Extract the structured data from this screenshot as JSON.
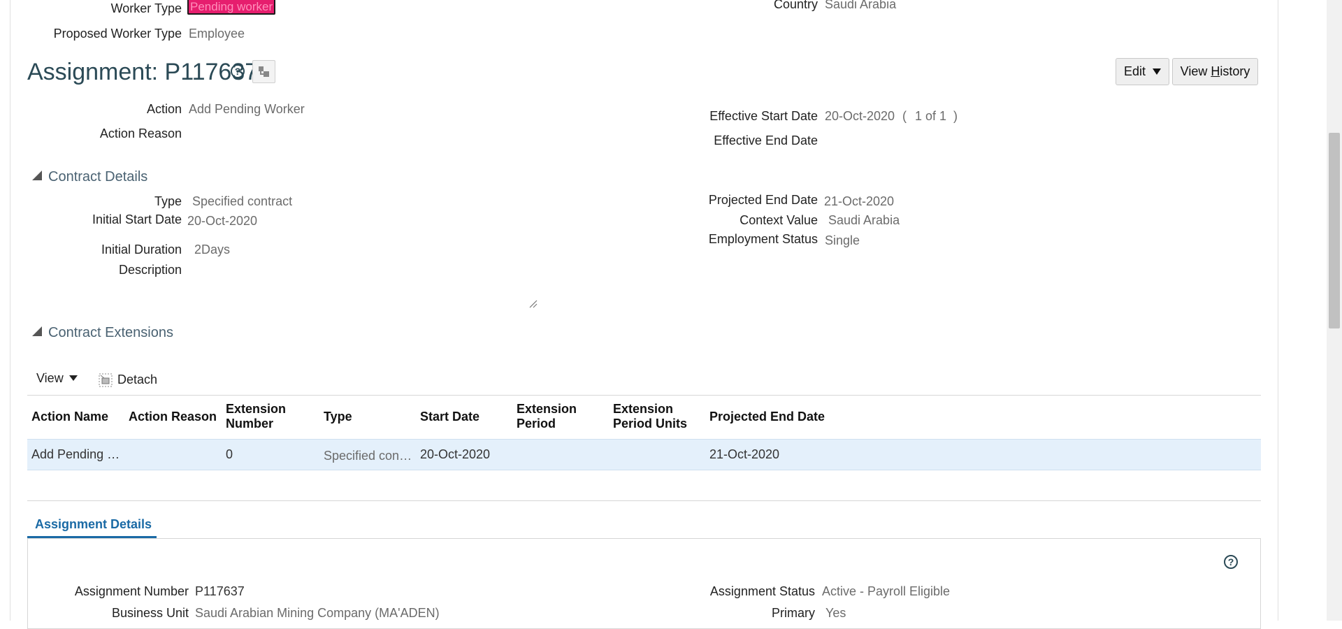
{
  "top": {
    "worker_type_label": "Worker Type",
    "worker_type_value": "Pending worker",
    "proposed_worker_type_label": "Proposed Worker Type",
    "proposed_worker_type_value": "Employee",
    "country_label": "Country",
    "country_value": "Saudi Arabia"
  },
  "assignment": {
    "title": "Assignment: P117637",
    "edit_label": "Edit",
    "view_history_pre": "View ",
    "view_history_ul": "H",
    "view_history_post": "istory",
    "action_label": "Action",
    "action_value": "Add Pending Worker",
    "action_reason_label": "Action Reason",
    "action_reason_value": "",
    "effective_start_label": "Effective Start Date",
    "effective_start_value": "20-Oct-2020",
    "effective_paren_open": "(",
    "effective_count": "1 of 1",
    "effective_paren_close": ")",
    "effective_end_label": "Effective End Date",
    "effective_end_value": ""
  },
  "contract_details": {
    "title": "Contract Details",
    "type_label": "Type",
    "type_value": "Specified contract",
    "initial_start_label": "Initial Start Date",
    "initial_start_value": "20-Oct-2020",
    "initial_duration_label": "Initial Duration",
    "initial_duration_value": "2Days",
    "description_label": "Description",
    "description_value": "",
    "projected_end_label": "Projected End Date",
    "projected_end_value": "21-Oct-2020",
    "context_value_label": "Context Value",
    "context_value_value": "Saudi Arabia",
    "employment_status_label": "Employment Status",
    "employment_status_value": "Single"
  },
  "contract_extensions": {
    "title": "Contract Extensions",
    "view_label": "View",
    "detach_label": "Detach",
    "columns": [
      {
        "line1": "Action Name",
        "line2": ""
      },
      {
        "line1": "Action Reason",
        "line2": ""
      },
      {
        "line1": "Extension",
        "line2": "Number"
      },
      {
        "line1": "Type",
        "line2": ""
      },
      {
        "line1": "Start Date",
        "line2": ""
      },
      {
        "line1": "Extension",
        "line2": "Period"
      },
      {
        "line1": "Extension",
        "line2": "Period Units"
      },
      {
        "line1": "Projected End Date",
        "line2": ""
      }
    ],
    "rows": [
      {
        "action_name": "Add Pending …",
        "action_reason": "",
        "extension_number": "0",
        "type": "Specified con…",
        "start_date": "20-Oct-2020",
        "extension_period": "",
        "extension_period_units": "",
        "projected_end_date": "21-Oct-2020"
      }
    ]
  },
  "assignment_details": {
    "tab_label": "Assignment Details",
    "assignment_number_label": "Assignment Number",
    "assignment_number_value": "P117637",
    "business_unit_label": "Business Unit",
    "business_unit_value": "Saudi Arabian Mining Company (MA'ADEN)",
    "assignment_status_label": "Assignment Status",
    "assignment_status_value": "Active - Payroll Eligible",
    "primary_label": "Primary",
    "primary_value": "Yes"
  },
  "icons": {
    "help": "question-mark-circle-icon",
    "hierarchy": "hierarchy-icon",
    "dropdown": "caret-down-icon",
    "detach": "detach-icon",
    "collapse": "collapse-triangle-icon"
  },
  "colors": {
    "accent_blue": "#1a6aa5",
    "title_teal": "#2b4a56",
    "pending_badge": "#e61e6e",
    "selected_row": "#e4f0fb"
  }
}
